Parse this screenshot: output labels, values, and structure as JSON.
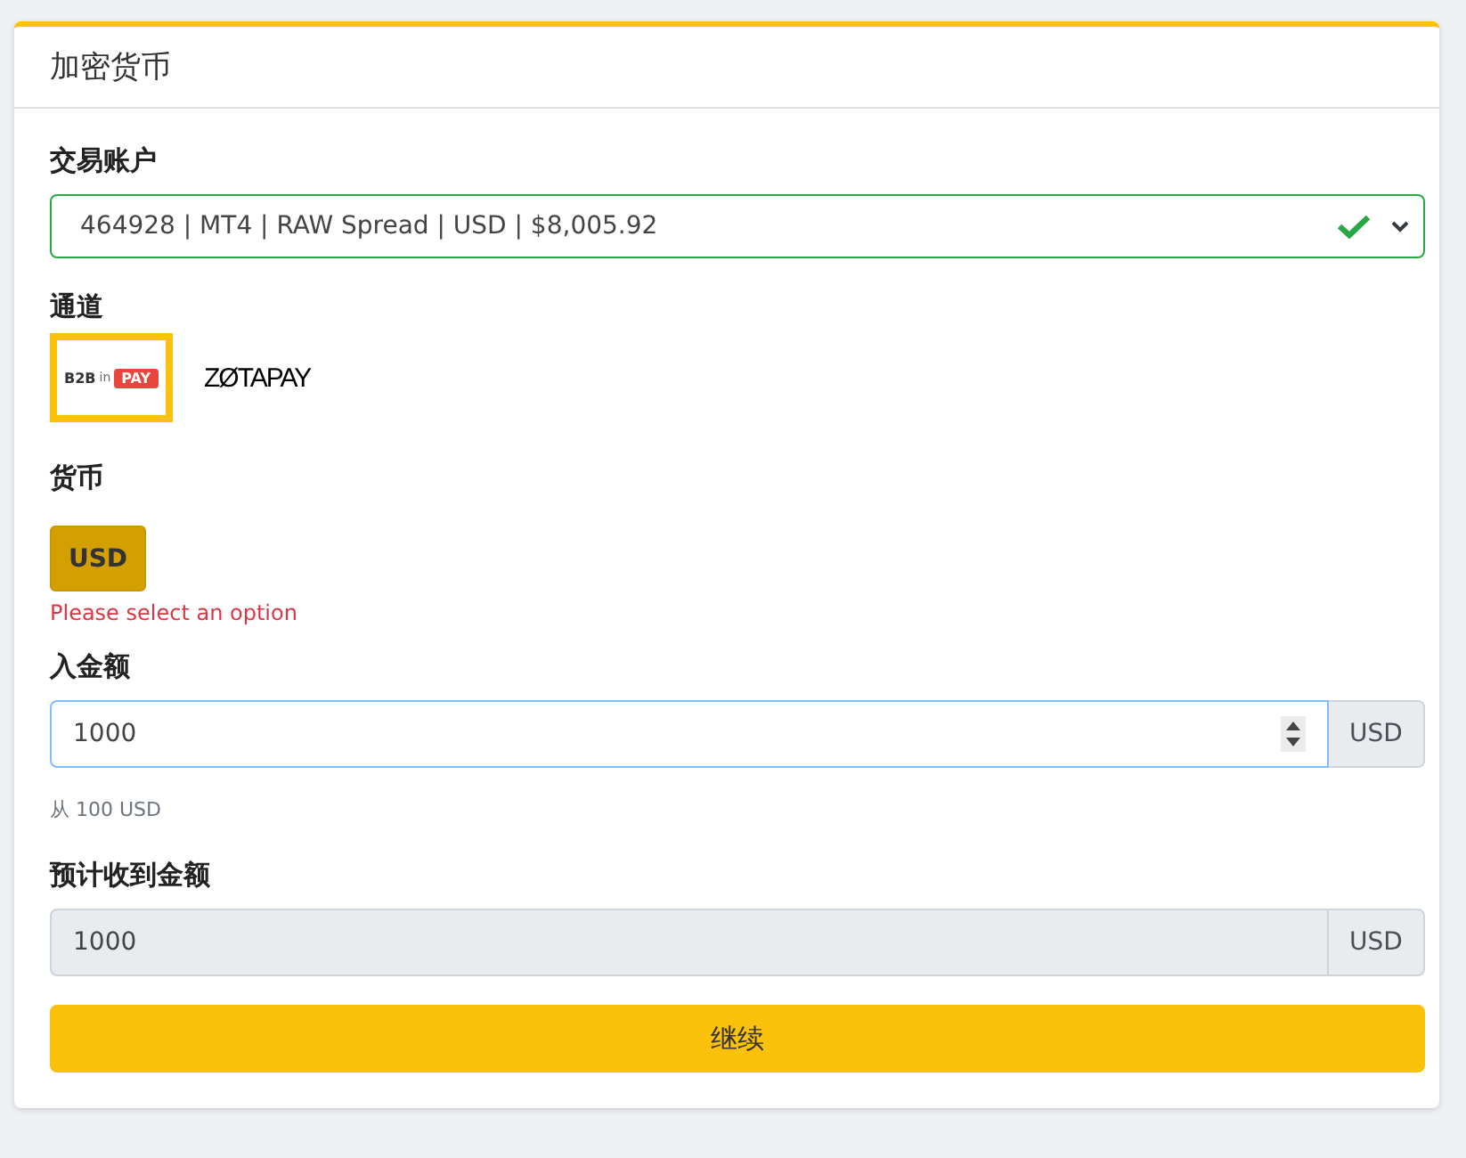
{
  "card": {
    "title": "加密货币"
  },
  "account": {
    "label": "交易账户",
    "value": "464928 | MT4 | RAW Spread | USD | $8,005.92",
    "valid": true
  },
  "channel": {
    "label": "通道",
    "options": [
      {
        "kind": "b2binpay",
        "parts": [
          "B2B",
          "in",
          "PAY"
        ],
        "selected": true
      },
      {
        "kind": "zotapay",
        "parts": [
          "ZØTAPAY"
        ],
        "selected": false
      }
    ]
  },
  "currency": {
    "label": "货币",
    "options": [
      {
        "label": "USD",
        "selected": true
      }
    ],
    "error": "Please select an option"
  },
  "amount": {
    "label": "入金额",
    "value": "1000",
    "unit": "USD",
    "hint": "从 100 USD"
  },
  "expected": {
    "label": "预计收到金额",
    "value": "1000",
    "unit": "USD"
  },
  "submit": "继续"
}
